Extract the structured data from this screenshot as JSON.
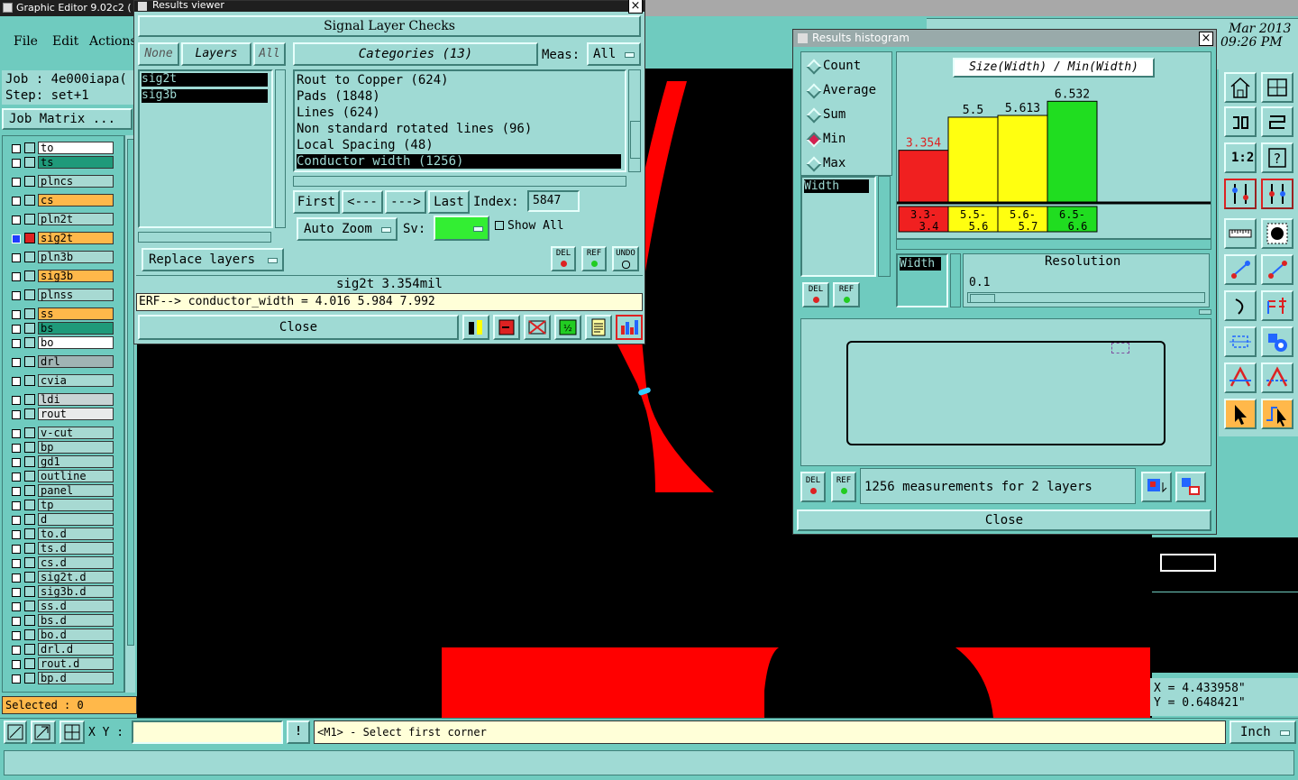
{
  "main_window": {
    "title": "Graphic Editor 9.02c2 (",
    "date_text": "Mar 2013",
    "time_text": "09:26 PM",
    "menu": [
      "File",
      "Edit",
      "Actions"
    ],
    "job_label": "Job : 4e000iapa(",
    "step_label": "Step: set+1",
    "job_matrix_button": "Job Matrix ..."
  },
  "layers": [
    {
      "name": "to",
      "color": "#ffffff"
    },
    {
      "name": "ts",
      "color": "#1f9a7a"
    },
    {
      "name": "plncs",
      "color": "#a7d9d2"
    },
    {
      "name": "cs",
      "color": "#ffb84a"
    },
    {
      "name": "pln2t",
      "color": "#a7d9d2"
    },
    {
      "name": "sig2t",
      "color": "#ffb84a",
      "selected": true
    },
    {
      "name": "pln3b",
      "color": "#a7d9d2"
    },
    {
      "name": "sig3b",
      "color": "#ffb84a"
    },
    {
      "name": "plnss",
      "color": "#a7d9d2"
    },
    {
      "name": "ss",
      "color": "#ffb84a"
    },
    {
      "name": "bs",
      "color": "#1f9a7a"
    },
    {
      "name": "bo",
      "color": "#ffffff"
    },
    {
      "name": "drl",
      "color": "#a0b4b4"
    },
    {
      "name": "cvia",
      "color": "#a7d9d2"
    },
    {
      "name": "ldi",
      "color": "#c8d4d4"
    },
    {
      "name": "rout",
      "color": "#e8eaea"
    },
    {
      "name": "v-cut",
      "color": "#a7d9d2"
    },
    {
      "name": "bp",
      "color": "#a7d9d2"
    },
    {
      "name": "gd1",
      "color": "#a7d9d2"
    },
    {
      "name": "outline",
      "color": "#a7d9d2"
    },
    {
      "name": "panel",
      "color": "#a7d9d2"
    },
    {
      "name": "tp",
      "color": "#a7d9d2"
    },
    {
      "name": "d",
      "color": "#a7d9d2"
    },
    {
      "name": "to.d",
      "color": "#a7d9d2"
    },
    {
      "name": "ts.d",
      "color": "#a7d9d2"
    },
    {
      "name": "cs.d",
      "color": "#a7d9d2"
    },
    {
      "name": "sig2t.d",
      "color": "#a7d9d2"
    },
    {
      "name": "sig3b.d",
      "color": "#a7d9d2"
    },
    {
      "name": "ss.d",
      "color": "#a7d9d2"
    },
    {
      "name": "bs.d",
      "color": "#a7d9d2"
    },
    {
      "name": "bo.d",
      "color": "#a7d9d2"
    },
    {
      "name": "drl.d",
      "color": "#a7d9d2"
    },
    {
      "name": "rout.d",
      "color": "#a7d9d2"
    },
    {
      "name": "bp.d",
      "color": "#a7d9d2"
    }
  ],
  "selected_count": "Selected : 0",
  "results_viewer": {
    "title": "Results viewer",
    "header": "Signal Layer Checks",
    "none_btn": "None",
    "layers_btn": "Layers",
    "all_btn": "All",
    "layer_list": [
      "sig2t",
      "sig3b"
    ],
    "categories_label": "Categories (13)",
    "meas_label": "Meas:",
    "meas_value": "All",
    "categories": [
      "Rout to Copper (624)",
      "Pads (1848)",
      "Lines (624)",
      "Non standard rotated lines (96)",
      "Local Spacing (48)",
      "Conductor width (1256)"
    ],
    "first_btn": "First",
    "prev_btn": "<---",
    "next_btn": "--->",
    "last_btn": "Last",
    "index_label": "Index:",
    "index_value": "5847",
    "auto_zoom": "Auto Zoom",
    "sv_label": "Sv:",
    "show_all": "Show All",
    "replace_layers": "Replace layers",
    "del_btn": "DEL",
    "ref_btn": "REF",
    "undo_btn": "UNDO",
    "status_line": "sig2t 3.354mil",
    "erf_line": "ERF--> conductor_width = 4.016 5.984 7.992",
    "close_btn": "Close"
  },
  "histogram": {
    "title": "Results histogram",
    "modes": [
      "Count",
      "Average",
      "Sum",
      "Min",
      "Max"
    ],
    "selected_mode": "Min",
    "chart_title": "Size(Width) / Min(Width)",
    "list_item": "Width",
    "del_btn": "DEL",
    "ref_btn": "REF",
    "field_label": "Width",
    "resolution_label": "Resolution",
    "resolution_value": "0.1",
    "measurements_text": "1256 measurements for 2 layers",
    "close_btn": "Close"
  },
  "chart_data": {
    "type": "bar",
    "title": "Size(Width) / Min(Width)",
    "categories": [
      "3.3-3.4",
      "5.5-5.6",
      "5.6-5.7",
      "6.5-6.6"
    ],
    "values": [
      3.354,
      5.5,
      5.613,
      6.532
    ],
    "value_labels": [
      "3.354",
      "5.5",
      "5.613",
      "6.532"
    ],
    "colors": [
      "#f02020",
      "#ffff10",
      "#ffff10",
      "#20dd20"
    ],
    "ylim": [
      0,
      7
    ],
    "grid": false
  },
  "coords": {
    "x": "X = 4.433958\"",
    "y": "Y = 0.648421\""
  },
  "bottom_bar": {
    "xy_label": "X Y :",
    "xy_value": "",
    "bang_btn": "!",
    "prompt": "<M1> - Select first corner",
    "units": "Inch"
  }
}
